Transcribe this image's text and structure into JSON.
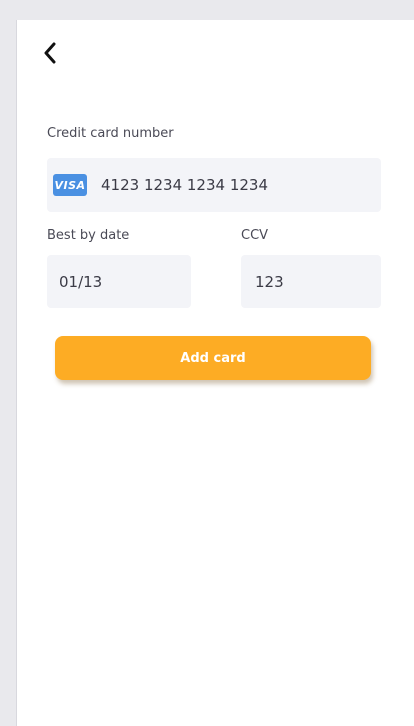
{
  "header": {
    "back_icon": "chevron-left-icon"
  },
  "form": {
    "card_number_label": "Credit card number",
    "card_brand": "VISA",
    "card_number_value": "4123 1234 1234 1234",
    "date_label": "Best by date",
    "date_value": "01/13",
    "ccv_label": "CCV",
    "ccv_value": "123"
  },
  "actions": {
    "add_card_label": "Add card"
  },
  "colors": {
    "accent": "#fdac24",
    "visa": "#4a90e2",
    "field_bg": "#f3f4f8"
  }
}
